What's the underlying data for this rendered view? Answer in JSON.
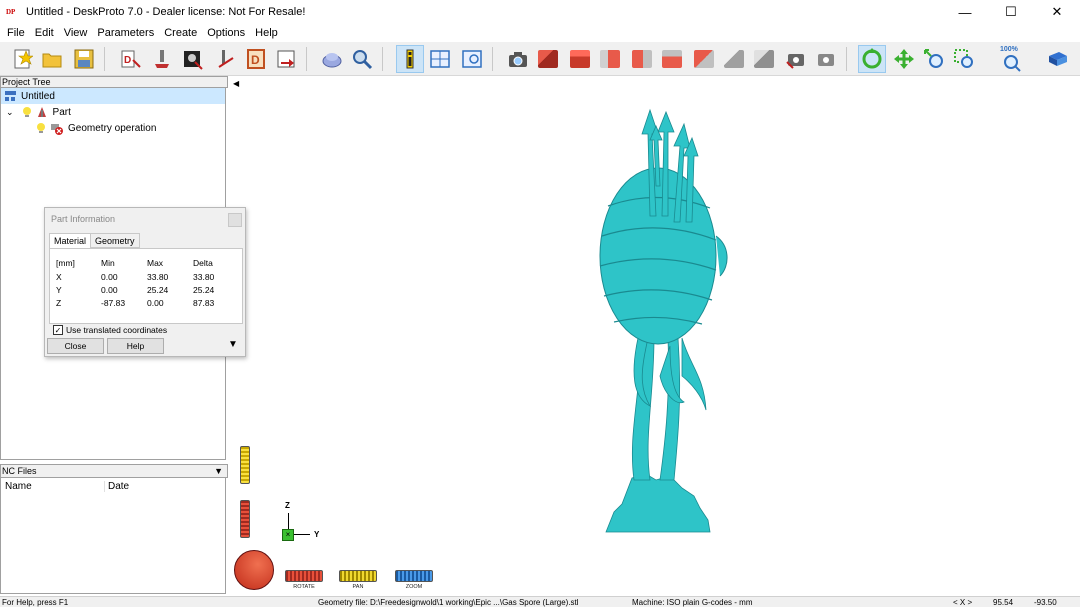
{
  "window": {
    "title": "Untitled - DeskProto 7.0 - Dealer license: Not For Resale!",
    "logo": "DP",
    "minimize": "—",
    "maximize": "☐",
    "close": "✕"
  },
  "menu": [
    "File",
    "Edit",
    "View",
    "Parameters",
    "Create",
    "Options",
    "Help"
  ],
  "toolbar": {
    "zoom_percent": "100%"
  },
  "project_tree": {
    "header": "Project Tree",
    "items": [
      {
        "label": "Untitled",
        "icon": "project-icon",
        "selected": true
      },
      {
        "label": "Part",
        "icon": "part-icon"
      },
      {
        "label": "Geometry operation",
        "icon": "geometry-error-icon"
      }
    ]
  },
  "nc_files": {
    "header": "NC Files",
    "columns": [
      "Name",
      "Date"
    ]
  },
  "part_info": {
    "title": "Part Information",
    "tabs": [
      "Material",
      "Geometry"
    ],
    "active_tab": "Material",
    "headers": [
      "[mm]",
      "Min",
      "Max",
      "Delta"
    ],
    "rows": [
      [
        "X",
        "0.00",
        "33.80",
        "33.80"
      ],
      [
        "Y",
        "0.00",
        "25.24",
        "25.24"
      ],
      [
        "Z",
        "-87.83",
        "0.00",
        "87.83"
      ]
    ],
    "checkbox_label": "Use translated coordinates",
    "checkbox_checked": true,
    "close_label": "Close",
    "help_label": "Help"
  },
  "viewport": {
    "axis_z": "Z",
    "axis_y": "Y",
    "model_color": "#2ec4c8",
    "modes": [
      {
        "label": "ROTATE",
        "color": "#d63a2a"
      },
      {
        "label": "PAN",
        "color": "#e8d020"
      },
      {
        "label": "ZOOM",
        "color": "#2a7fd4"
      }
    ]
  },
  "status": {
    "help": "For Help, press F1",
    "geometry_file": "Geometry file: D:\\Freedesignwold\\1 working\\Epic ...\\Gas Spore (Large).stl",
    "machine": "Machine: ISO plain G-codes - mm",
    "coord_label": "< X >",
    "coord_x": "95.54",
    "coord_y": "-93.50"
  }
}
